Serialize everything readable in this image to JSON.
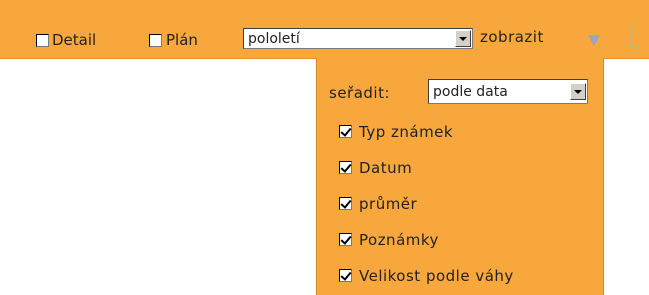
{
  "toolbar": {
    "detail": {
      "label": "Detail",
      "checked": false
    },
    "plan": {
      "label": "Plán",
      "checked": false
    },
    "period_select": {
      "value": "pololetí"
    },
    "show_label": "zobrazit",
    "show_toggle_icon": "triangle-down-icon",
    "info_icon": "info-icon"
  },
  "panel": {
    "sort": {
      "label": "seřadit:",
      "value": "podle data"
    },
    "options": [
      {
        "label": "Typ známek",
        "checked": true
      },
      {
        "label": "Datum",
        "checked": true
      },
      {
        "label": "průměr",
        "checked": true
      },
      {
        "label": "Poznámky",
        "checked": true
      },
      {
        "label": "Velikost podle váhy",
        "checked": true
      }
    ]
  },
  "colors": {
    "bar": "#f8a73d",
    "toggle_icon": "#9aa3c8"
  }
}
